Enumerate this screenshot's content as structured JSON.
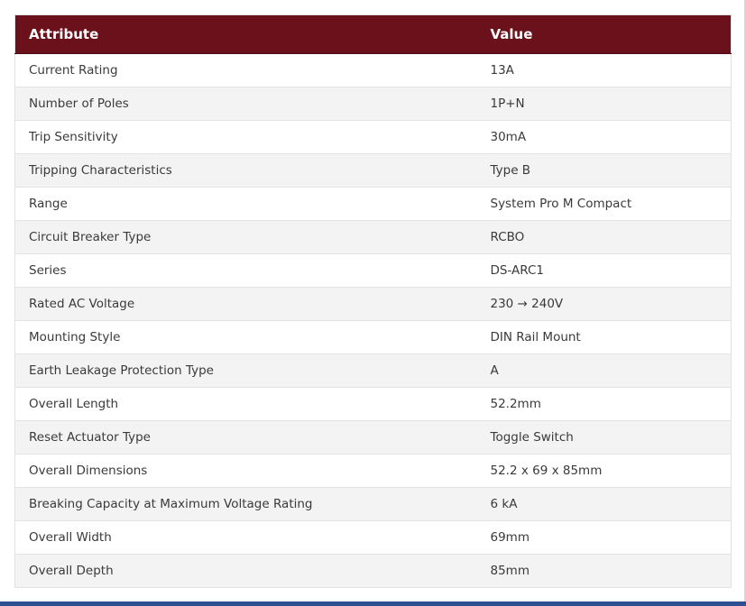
{
  "table": {
    "headers": [
      "Attribute",
      "Value"
    ],
    "rows": [
      {
        "attribute": "Current Rating",
        "value": "13A"
      },
      {
        "attribute": "Number of Poles",
        "value": "1P+N"
      },
      {
        "attribute": "Trip Sensitivity",
        "value": "30mA"
      },
      {
        "attribute": "Tripping Characteristics",
        "value": "Type B"
      },
      {
        "attribute": "Range",
        "value": "System Pro M Compact"
      },
      {
        "attribute": "Circuit Breaker Type",
        "value": "RCBO"
      },
      {
        "attribute": "Series",
        "value": "DS-ARC1"
      },
      {
        "attribute": "Rated AC Voltage",
        "value": "230 → 240V"
      },
      {
        "attribute": "Mounting Style",
        "value": "DIN Rail Mount"
      },
      {
        "attribute": "Earth Leakage Protection Type",
        "value": "A"
      },
      {
        "attribute": "Overall Length",
        "value": "52.2mm"
      },
      {
        "attribute": "Reset Actuator Type",
        "value": "Toggle Switch"
      },
      {
        "attribute": "Overall Dimensions",
        "value": "52.2 x 69 x 85mm"
      },
      {
        "attribute": "Breaking Capacity at Maximum Voltage Rating",
        "value": "6 kA"
      },
      {
        "attribute": "Overall Width",
        "value": "69mm"
      },
      {
        "attribute": "Overall Depth",
        "value": "85mm"
      }
    ]
  },
  "colors": {
    "header_bg": "#6b111c",
    "header_text": "#ffffff",
    "row_alt_bg": "#f3f3f3",
    "bottom_bar": "#2f4f93"
  }
}
